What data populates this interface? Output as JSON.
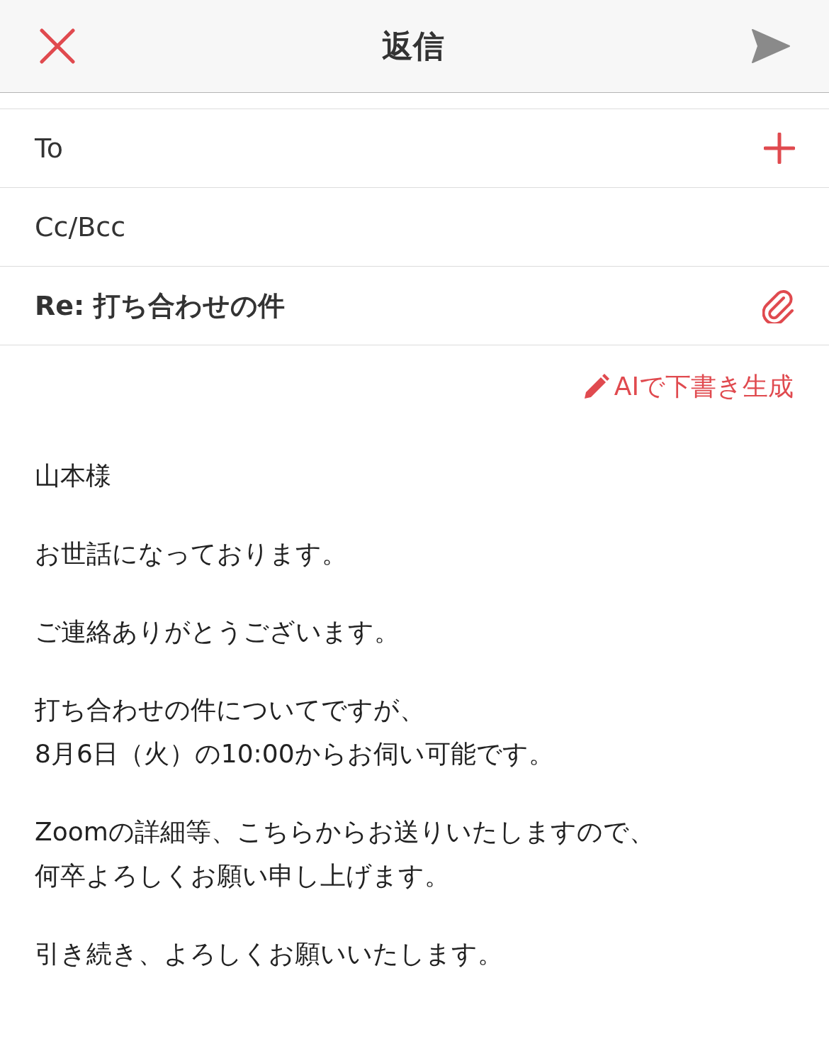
{
  "header": {
    "title": "返信"
  },
  "fields": [
    {
      "kind": "recipient",
      "label": "To"
    },
    {
      "kind": "plain",
      "label": "Cc/Bcc"
    },
    {
      "kind": "subject",
      "label": "Re: 打ち合わせの件"
    }
  ],
  "ai_action": {
    "label": "AIで下書き生成"
  },
  "body": [
    [
      "山本様"
    ],
    [
      "お世話になっております。"
    ],
    [
      "ご連絡ありがとうございます。"
    ],
    [
      "打ち合わせの件についてですが、",
      "8月6日（火）の10:00からお伺い可能です。"
    ],
    [
      "Zoomの詳細等、こちらからお送りいたしますので、",
      "何卒よろしくお願い申し上げます。"
    ],
    [
      "引き続き、よろしくお願いいたします。"
    ]
  ]
}
